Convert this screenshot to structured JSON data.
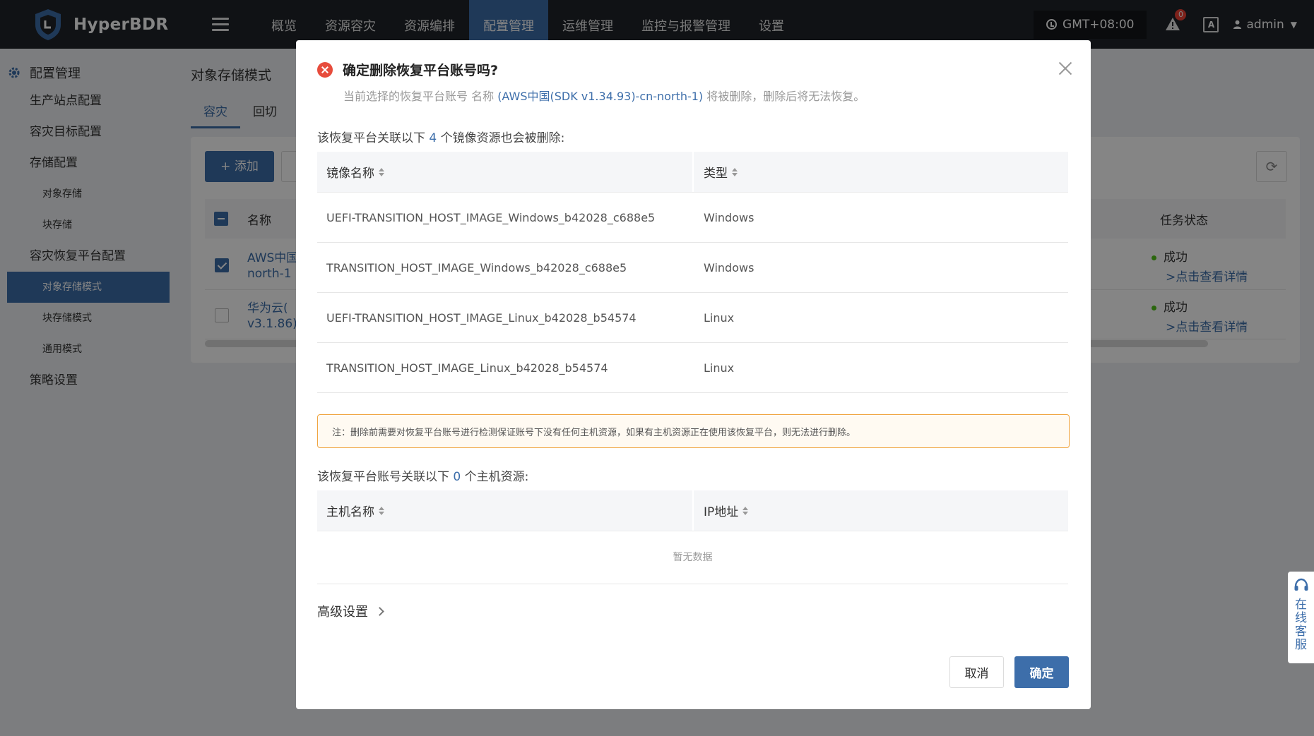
{
  "app": {
    "name": "HyperBDR",
    "colors": {
      "topbar": "#1f2329",
      "accent": "#3d6eaa",
      "danger": "#e74c3c",
      "warning_border": "#f0a540",
      "success": "#52c41a"
    }
  },
  "topnav": {
    "items": [
      {
        "label": "概览"
      },
      {
        "label": "资源容灾"
      },
      {
        "label": "资源编排"
      },
      {
        "label": "配置管理"
      },
      {
        "label": "运维管理"
      },
      {
        "label": "监控与报警管理"
      },
      {
        "label": "设置"
      }
    ],
    "active_index": 3,
    "timezone": "GMT+08:00",
    "alert_count": "0",
    "lang_icon": "A",
    "user": "admin"
  },
  "sidebar": {
    "group_title": "配置管理",
    "items": [
      {
        "label": "生产站点配置"
      },
      {
        "label": "容灾目标配置"
      },
      {
        "label": "存储配置"
      },
      {
        "label": "对象存储"
      },
      {
        "label": "块存储"
      },
      {
        "label": "容灾恢复平台配置"
      },
      {
        "label": "对象存储模式"
      },
      {
        "label": "块存储模式"
      },
      {
        "label": "通用模式"
      },
      {
        "label": "策略设置"
      }
    ]
  },
  "background": {
    "page_title": "对象存储模式",
    "tabs": [
      {
        "label": "容灾"
      },
      {
        "label": "回切"
      }
    ],
    "add_button": "+ 添加",
    "col_name": "名称",
    "col_status": "任务状态",
    "rows": [
      {
        "name_line1": "AWS中国",
        "name_line2": "north-1",
        "status": "成功",
        "detail": ">点击查看详情"
      },
      {
        "name_line1": "华为云(",
        "name_line2": "v3.1.86)-",
        "status": "成功",
        "detail": ">点击查看详情"
      }
    ]
  },
  "modal": {
    "title": "确定删除恢复平台账号吗?",
    "subtitle_prefix": "当前选择的恢复平台账号 名称",
    "subtitle_highlight": "(AWS中国(SDK v1.34.93)-cn-north-1)",
    "subtitle_suffix": "将被删除，删除后将无法恢复。",
    "images_label_prefix": "该恢复平台关联以下",
    "images_count": "4",
    "images_label_suffix": "个镜像资源也会被删除:",
    "images_table": {
      "col_name": "镜像名称",
      "col_type": "类型",
      "rows": [
        {
          "name": "UEFI-TRANSITION_HOST_IMAGE_Windows_b42028_c688e5",
          "type": "Windows"
        },
        {
          "name": "TRANSITION_HOST_IMAGE_Windows_b42028_c688e5",
          "type": "Windows"
        },
        {
          "name": "UEFI-TRANSITION_HOST_IMAGE_Linux_b42028_b54574",
          "type": "Linux"
        },
        {
          "name": "TRANSITION_HOST_IMAGE_Linux_b42028_b54574",
          "type": "Linux"
        }
      ]
    },
    "note": "注：删除前需要对恢复平台账号进行检测保证账号下没有任何主机资源，如果有主机资源正在使用该恢复平台，则无法进行删除。",
    "hosts_label_prefix": "该恢复平台账号关联以下",
    "hosts_count": "0",
    "hosts_label_suffix": "个主机资源:",
    "hosts_table": {
      "col_name": "主机名称",
      "col_ip": "IP地址",
      "empty_text": "暂无数据"
    },
    "advanced": "高级设置",
    "cancel": "取消",
    "confirm": "确定"
  },
  "service": {
    "label": "在线客服"
  }
}
